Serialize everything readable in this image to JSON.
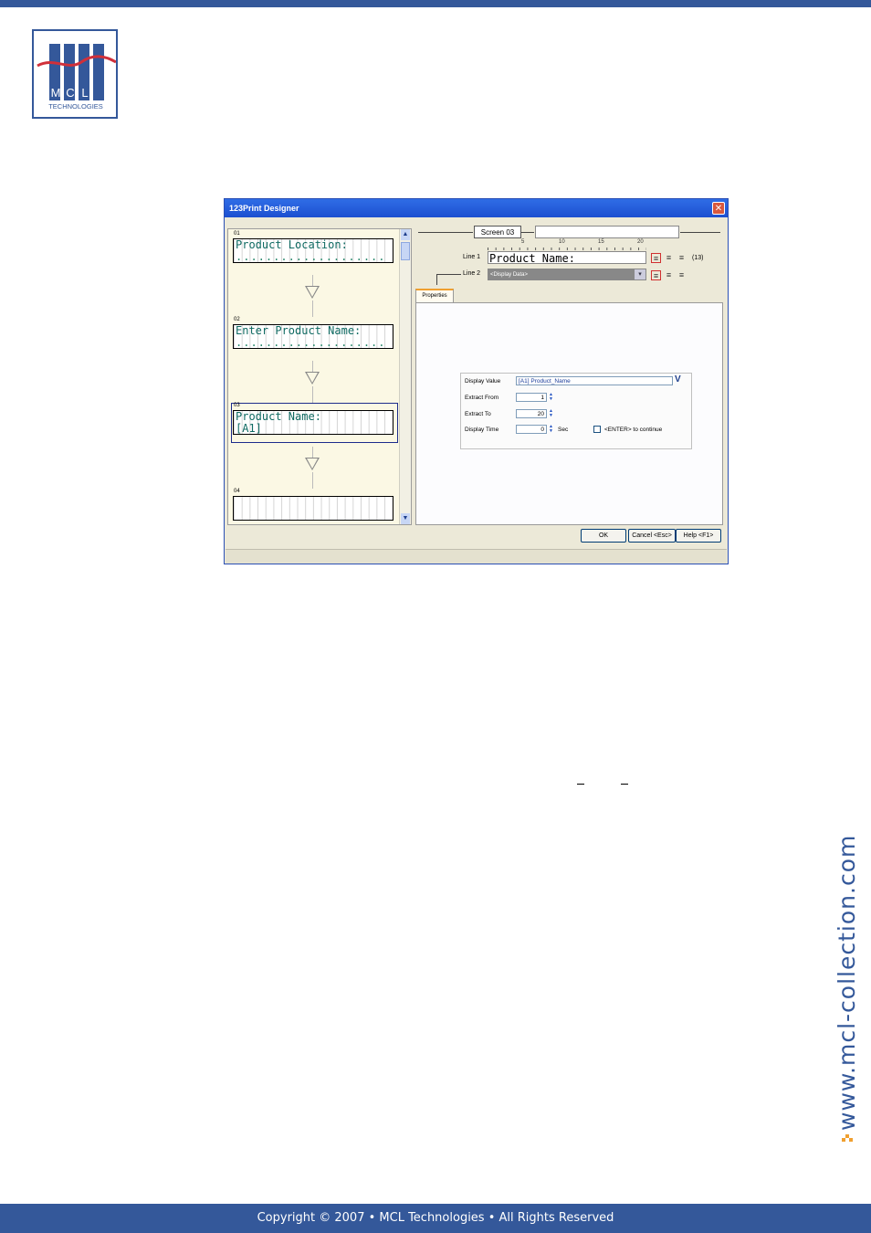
{
  "logo": {
    "letters": [
      "M",
      "C",
      "L"
    ],
    "subtitle": "TECHNOLOGIES"
  },
  "dialog": {
    "title": "123Print Designer",
    "close_label": "✕",
    "screens": [
      {
        "number": "01",
        "line1": "Product Location:",
        "line2": "...................."
      },
      {
        "number": "02",
        "line1": "Enter Product Name:",
        "line2": "...................."
      },
      {
        "number": "03",
        "line1": "Product Name:",
        "line2": "[A1]"
      },
      {
        "number": "04",
        "line1": "",
        "line2": ""
      }
    ],
    "screen_label": "Screen 03",
    "screen_name_value": "",
    "ruler": [
      "5",
      "10",
      "15",
      "20"
    ],
    "line1_label": "Line 1",
    "line1_value": "Product Name:",
    "line1_count": "(13)",
    "line2_label": "Line 2",
    "line2_value": "<Display Data>",
    "tab_label": "Properties",
    "properties": {
      "display_value_label": "Display Value",
      "display_value": "[A1] Product_Name",
      "extract_from_label": "Extract From",
      "extract_from": "1",
      "extract_to_label": "Extract To",
      "extract_to": "20",
      "display_time_label": "Display Time",
      "display_time": "0",
      "sec_label": "Sec",
      "enter_continue_label": "<ENTER> to continue"
    },
    "buttons": {
      "ok": "OK",
      "cancel": "Cancel <Esc>",
      "help": "Help <F1>"
    }
  },
  "side_url": "www.mcl-collection.com",
  "footer": "Copyright © 2007 • MCL Technologies • All Rights Reserved",
  "colors": {
    "brand": "#34589a",
    "accent": "#f0a030",
    "lcd_text": "#0f6a62"
  }
}
